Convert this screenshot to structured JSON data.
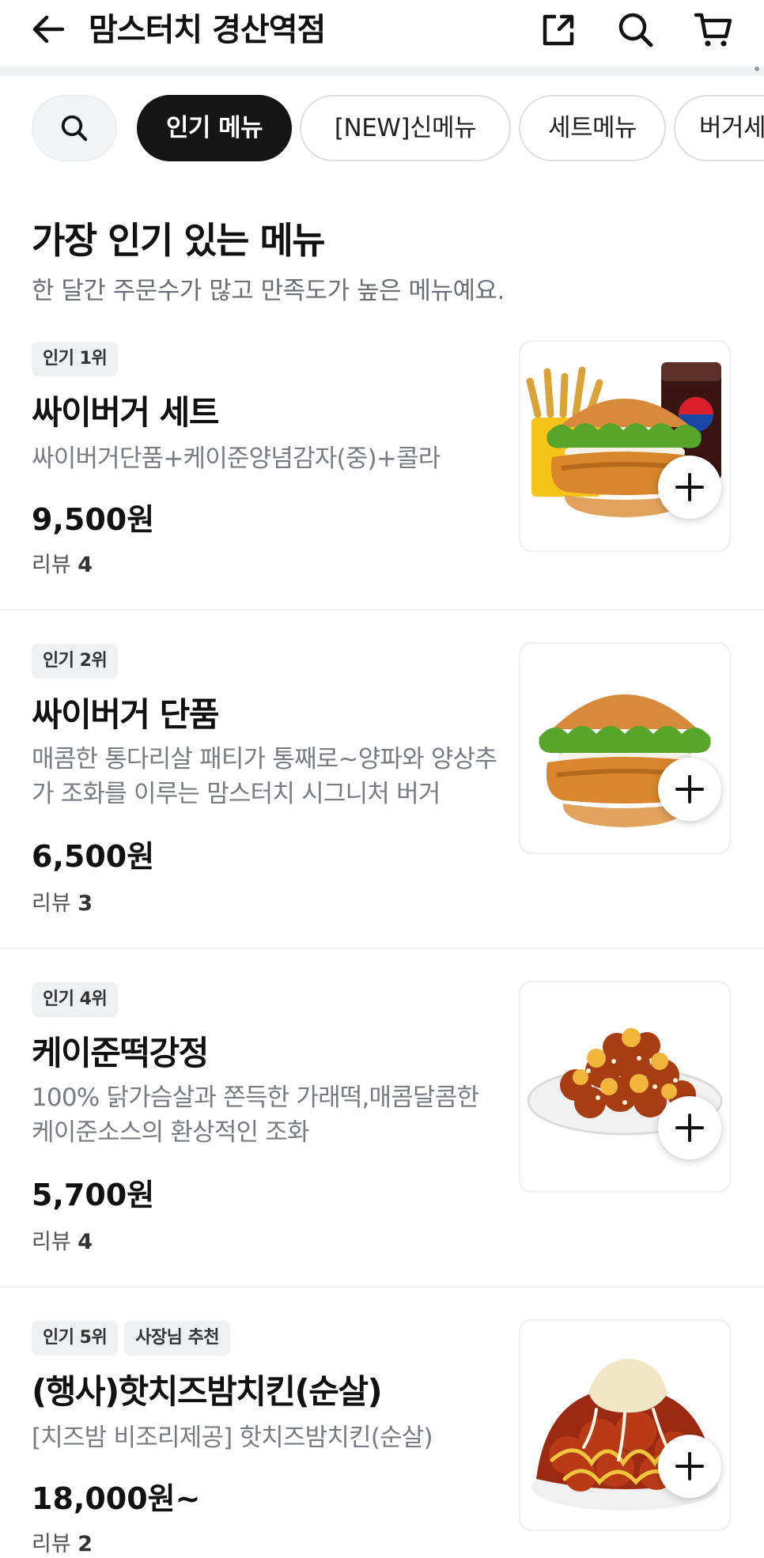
{
  "header": {
    "title": "맘스터치 경산역점",
    "back_icon": "arrow-left-icon",
    "share_icon": "share-icon",
    "search_icon": "search-icon",
    "cart_icon": "cart-icon"
  },
  "categories": {
    "search_icon": "search-icon",
    "items": [
      {
        "label": "인기 메뉴",
        "active": true
      },
      {
        "label": "[NEW]신메뉴",
        "active": false
      },
      {
        "label": "세트메뉴",
        "active": false
      },
      {
        "label": "버거세",
        "active": false
      }
    ]
  },
  "section": {
    "title": "가장 인기 있는 메뉴",
    "subtitle": "한 달간 주문수가 많고 만족도가 높은 메뉴예요."
  },
  "menu": [
    {
      "tags": [
        "인기 1위"
      ],
      "name": "싸이버거 세트",
      "desc": "싸이버거단품+케이준양념감자(중)+콜라",
      "price": "9,500원",
      "review_label": "리뷰",
      "review_count": "4",
      "image": "burger-set"
    },
    {
      "tags": [
        "인기 2위"
      ],
      "name": "싸이버거 단품",
      "desc": "매콤한 통다리살 패티가 통째로~양파와 양상추가 조화를 이루는 맘스터치 시그니처 버거",
      "price": "6,500원",
      "review_label": "리뷰",
      "review_count": "3",
      "image": "burger"
    },
    {
      "tags": [
        "인기 4위"
      ],
      "name": "케이준떡강정",
      "desc": "100% 닭가슴살과 쫀득한 가래떡,매콤달콤한 케이준소스의 환상적인 조화",
      "price": "5,700원",
      "review_label": "리뷰",
      "review_count": "4",
      "image": "gangjeong"
    },
    {
      "tags": [
        "인기 5위",
        "사장님 추천"
      ],
      "name": "(행사)핫치즈밤치킨(순살)",
      "desc": "[치즈밤 비조리제공] 핫치즈밤치킨(순살)",
      "price": "18,000원~",
      "review_label": "리뷰",
      "review_count": "2",
      "image": "cheese-chicken"
    }
  ],
  "colors": {
    "active_chip": "#151515",
    "divider": "#eff0f2",
    "muted_text": "#787b81"
  }
}
